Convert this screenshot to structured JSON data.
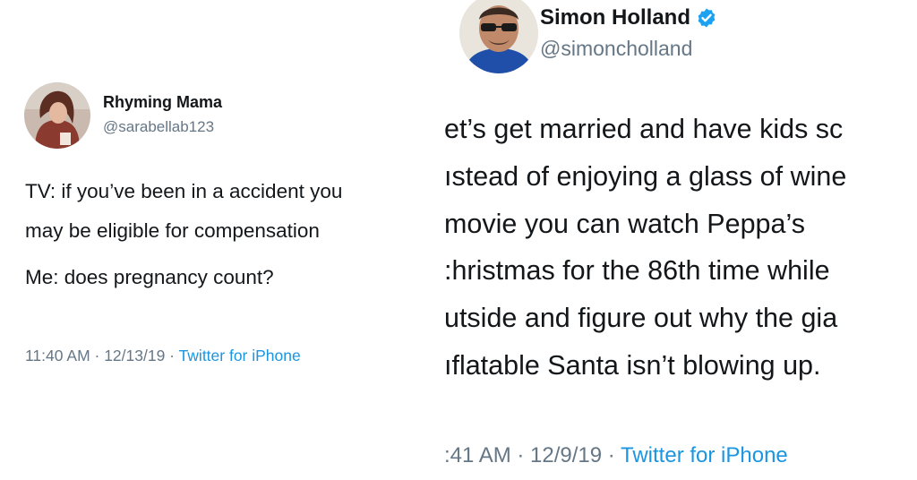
{
  "left_tweet": {
    "name": "Rhyming Mama",
    "handle": "@sarabellab123",
    "lines": [
      "TV: if you’ve been in a accident you",
      "may be eligible for compensation",
      "Me: does pregnancy count?"
    ],
    "time": "11:40 AM · 12/13/19 · ",
    "source": "Twitter for iPhone"
  },
  "right_tweet": {
    "name": "Simon Holland",
    "handle": "@simoncholland",
    "lines": [
      "et’s get married and have kids sc",
      "ıstead of enjoying a glass of wine",
      " movie you can watch Peppa’s",
      ":hristmas for the 86th time while",
      "utside and figure out why the gia",
      "ıflatable Santa isn’t blowing up."
    ],
    "time": ":41 AM · 12/9/19 · ",
    "source": "Twitter for iPhone"
  },
  "colors": {
    "text": "#14171a",
    "secondary": "#657786",
    "link": "#1b95e0",
    "verified": "#1da1f2"
  },
  "icons": {
    "verified": "verified-badge-icon"
  }
}
